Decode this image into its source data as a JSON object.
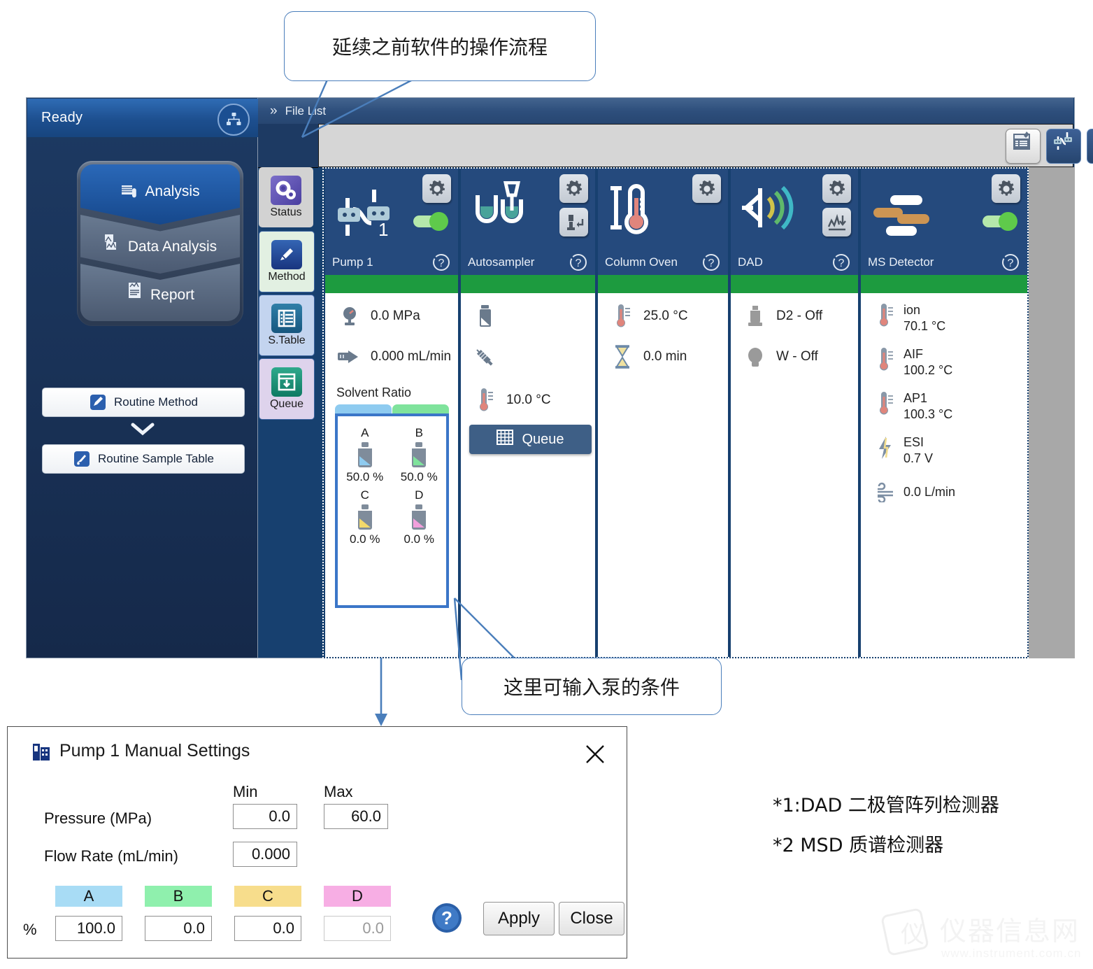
{
  "annotations": {
    "top_callout": "延续之前软件的操作流程",
    "pump_callout": "这里可输入泵的条件",
    "footnote_1": "*1:DAD 二极管阵列检测器",
    "footnote_2": "*2 MSD 质谱检测器"
  },
  "left_nav": {
    "status": "Ready",
    "network_icon": "network-icon",
    "workflow": [
      {
        "label": "Analysis",
        "icon": "analysis-icon",
        "selected": true
      },
      {
        "label": "Data Analysis",
        "icon": "data-analysis-icon",
        "selected": false
      },
      {
        "label": "Report",
        "icon": "report-icon",
        "selected": false
      }
    ],
    "routine_method": "Routine Method",
    "routine_sample_table": "Routine Sample Table",
    "expand_icon": "chevron-down-icon"
  },
  "titlebar": {
    "expand_icon": "double-chevron-right-icon",
    "title": "File List"
  },
  "toolbar": {
    "buttons": [
      {
        "name": "instrument-monitor-icon",
        "selected": true
      },
      {
        "name": "pump-icon",
        "selected": false
      },
      {
        "name": "autosampler-icon",
        "selected": false
      },
      {
        "name": "column-oven-icon",
        "selected": false
      },
      {
        "name": "dad-detector-icon",
        "selected": false
      },
      {
        "name": "ms-detector-icon",
        "selected": false
      }
    ]
  },
  "module_tabs": [
    {
      "label": "Status",
      "icon": "gears-icon",
      "selected": true
    },
    {
      "label": "Method",
      "icon": "pencil-icon",
      "selected": false
    },
    {
      "label": "S.Table",
      "icon": "table-icon",
      "selected": false
    },
    {
      "label": "Queue",
      "icon": "queue-icon",
      "selected": false
    }
  ],
  "devices": [
    {
      "name": "Pump 1",
      "icon": "pump-icon",
      "status_color": "#1d9b3f",
      "has_toggle": true,
      "toggle_on": true,
      "readings": [
        {
          "icon": "pressure-gauge-icon",
          "value": "0.0 MPa"
        },
        {
          "icon": "flow-arrow-icon",
          "value": "0.000 mL/min"
        }
      ],
      "solvent_ratio_label": "Solvent Ratio",
      "solvents": [
        {
          "label": "A",
          "percent": "50.0 %",
          "color": "#8ecbf0"
        },
        {
          "label": "B",
          "percent": "50.0 %",
          "color": "#7fe39c"
        },
        {
          "label": "C",
          "percent": "0.0 %",
          "color": "#f2d96b"
        },
        {
          "label": "D",
          "percent": "0.0 %",
          "color": "#f29fdc"
        }
      ]
    },
    {
      "name": "Autosampler",
      "icon": "autosampler-icon",
      "status_color": "#1d9b3f",
      "has_toggle": false,
      "readings": [
        {
          "icon": "vial-icon",
          "value": ""
        },
        {
          "icon": "syringe-icon",
          "value": ""
        },
        {
          "icon": "thermometer-icon",
          "value": "10.0 °C"
        }
      ],
      "queue_button": "Queue"
    },
    {
      "name": "Column Oven",
      "icon": "column-oven-icon",
      "status_color": "#1d9b3f",
      "has_toggle": false,
      "readings": [
        {
          "icon": "thermometer-icon",
          "value": "25.0 °C"
        },
        {
          "icon": "hourglass-icon",
          "value": "0.0 min"
        }
      ]
    },
    {
      "name": "DAD",
      "icon": "dad-detector-icon",
      "status_color": "#1d9b3f",
      "has_toggle": false,
      "readings": [
        {
          "icon": "d2-lamp-icon",
          "value": "D2 - Off"
        },
        {
          "icon": "w-lamp-icon",
          "value": "W - Off"
        }
      ]
    },
    {
      "name": "MS Detector",
      "icon": "ms-detector-icon",
      "status_color": "#1d9b3f",
      "has_toggle": true,
      "toggle_on": true,
      "readings": [
        {
          "icon": "thermometer-icon",
          "label": "ion",
          "value": "70.1 °C"
        },
        {
          "icon": "thermometer-icon",
          "label": "AIF",
          "value": "100.2 °C"
        },
        {
          "icon": "thermometer-icon",
          "label": "AP1",
          "value": "100.3 °C"
        },
        {
          "icon": "bolt-icon",
          "label": "ESI",
          "value": "0.7 V"
        },
        {
          "icon": "gas-flow-icon",
          "label": "",
          "value": "0.0 L/min"
        }
      ]
    }
  ],
  "dialog": {
    "title": "Pump 1 Manual Settings",
    "icon": "pump-settings-icon",
    "close_icon": "close-icon",
    "col_min": "Min",
    "col_max": "Max",
    "pressure_label": "Pressure (MPa)",
    "pressure_min": "0.0",
    "pressure_max": "60.0",
    "flow_label": "Flow Rate (mL/min)",
    "flow_value": "0.000",
    "percent_symbol": "%",
    "solvents": [
      {
        "label": "A",
        "value": "100.0",
        "color": "#a8dcf5",
        "disabled": false
      },
      {
        "label": "B",
        "value": "0.0",
        "color": "#8ff0ad",
        "disabled": false
      },
      {
        "label": "C",
        "value": "0.0",
        "color": "#f7dd8c",
        "disabled": false
      },
      {
        "label": "D",
        "value": "0.0",
        "color": "#f7aee4",
        "disabled": true
      }
    ],
    "help_icon": "help-icon",
    "apply_label": "Apply",
    "close_label": "Close"
  },
  "watermark": {
    "text": "仪器信息网",
    "url": "www.instrument.com.cn"
  },
  "colors": {
    "accent_blue": "#254a7d",
    "status_green": "#1d9b3f",
    "titlebar": "#2e4f7c",
    "callout_border": "#4a7ebb"
  }
}
